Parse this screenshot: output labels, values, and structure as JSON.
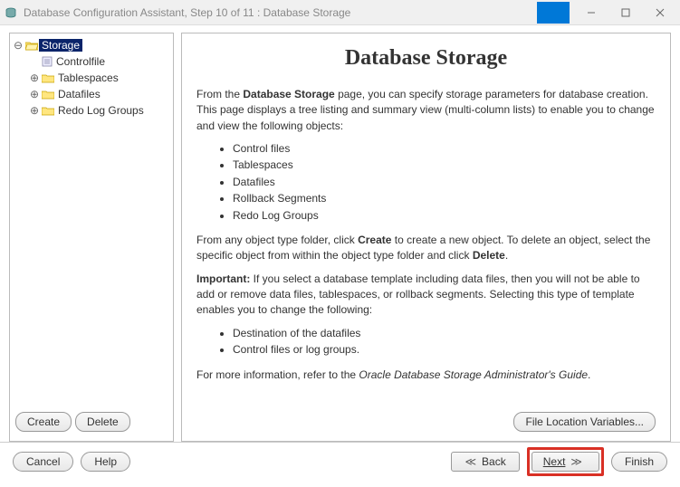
{
  "titlebar": {
    "text": "Database Configuration Assistant, Step 10 of 11 : Database Storage"
  },
  "tree": {
    "root": {
      "label": "Storage"
    },
    "items": [
      {
        "label": "Controlfile"
      },
      {
        "label": "Tablespaces"
      },
      {
        "label": "Datafiles"
      },
      {
        "label": "Redo Log Groups"
      }
    ],
    "buttons": {
      "create": "Create",
      "delete": "Delete"
    }
  },
  "content": {
    "heading": "Database Storage",
    "para1a": "From the ",
    "para1b": "Database Storage",
    "para1c": " page, you can specify storage parameters for database creation. This page displays a tree listing and summary view (multi-column lists) to enable you to change and view the following objects:",
    "list1": [
      "Control files",
      "Tablespaces",
      "Datafiles",
      "Rollback Segments",
      "Redo Log Groups"
    ],
    "para2a": "From any object type folder, click ",
    "para2b": "Create",
    "para2c": " to create a new object. To delete an object, select the specific object from within the object type folder and click ",
    "para2d": "Delete",
    "para2e": ".",
    "para3a": "Important:",
    "para3b": " If you select a database template including data files, then you will not be able to add or remove data files, tablespaces, or rollback segments. Selecting this type of template enables you to change the following:",
    "list2": [
      "Destination of the datafiles",
      "Control files or log groups."
    ],
    "para4a": "For more information, refer to the ",
    "para4b": "Oracle Database Storage Administrator's Guide",
    "para4c": ".",
    "filelocations": "File Location Variables..."
  },
  "bottom": {
    "cancel": "Cancel",
    "help": "Help",
    "back": "Back",
    "next": "Next",
    "finish": "Finish"
  }
}
